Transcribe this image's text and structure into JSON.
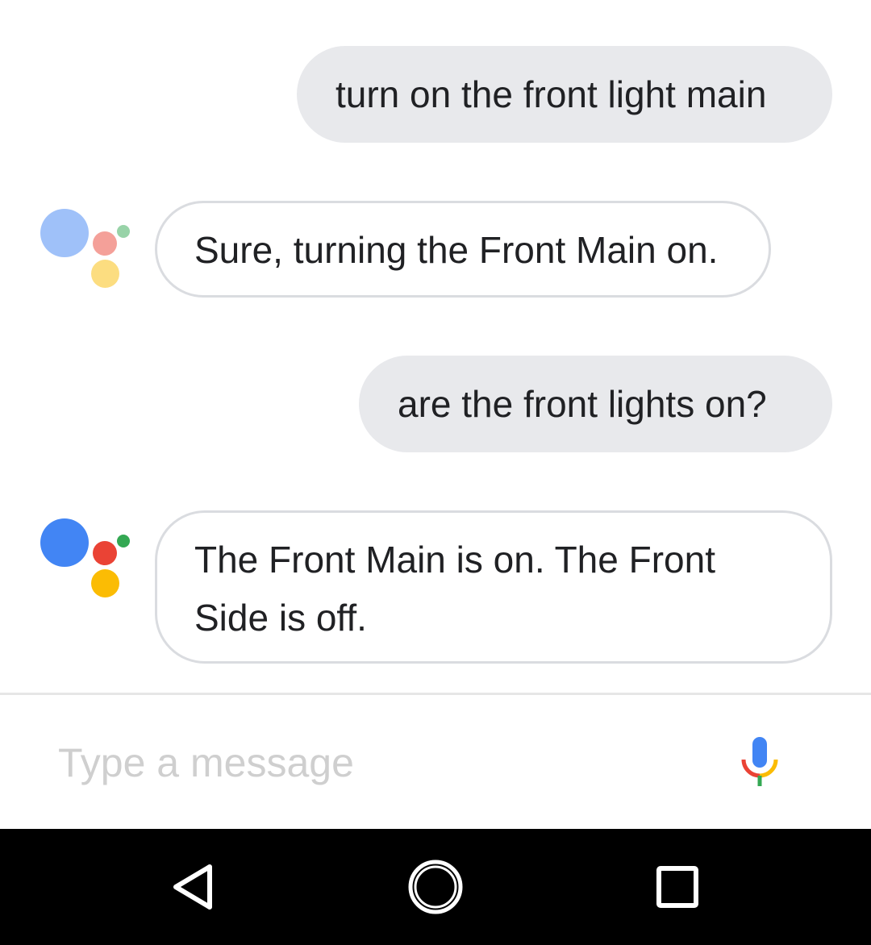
{
  "conversation": [
    {
      "role": "user",
      "text": "turn on the front light main"
    },
    {
      "role": "assistant",
      "text": "Sure, turning the Front Main on."
    },
    {
      "role": "user",
      "text": "are the front lights on?"
    },
    {
      "role": "assistant",
      "text": "The Front Main is on. The Front Side is off."
    }
  ],
  "composer": {
    "placeholder": "Type a message",
    "value": "",
    "mic_icon": "microphone-icon"
  },
  "assistant_avatar": {
    "icon": "google-assistant-dots-icon",
    "colors": {
      "blue": "#4285f4",
      "red": "#ea4335",
      "yellow": "#fbbc04",
      "green": "#34a853"
    }
  },
  "nav_bar": {
    "back_icon": "back-triangle-icon",
    "home_icon": "home-circle-icon",
    "recents_icon": "recents-square-icon"
  }
}
